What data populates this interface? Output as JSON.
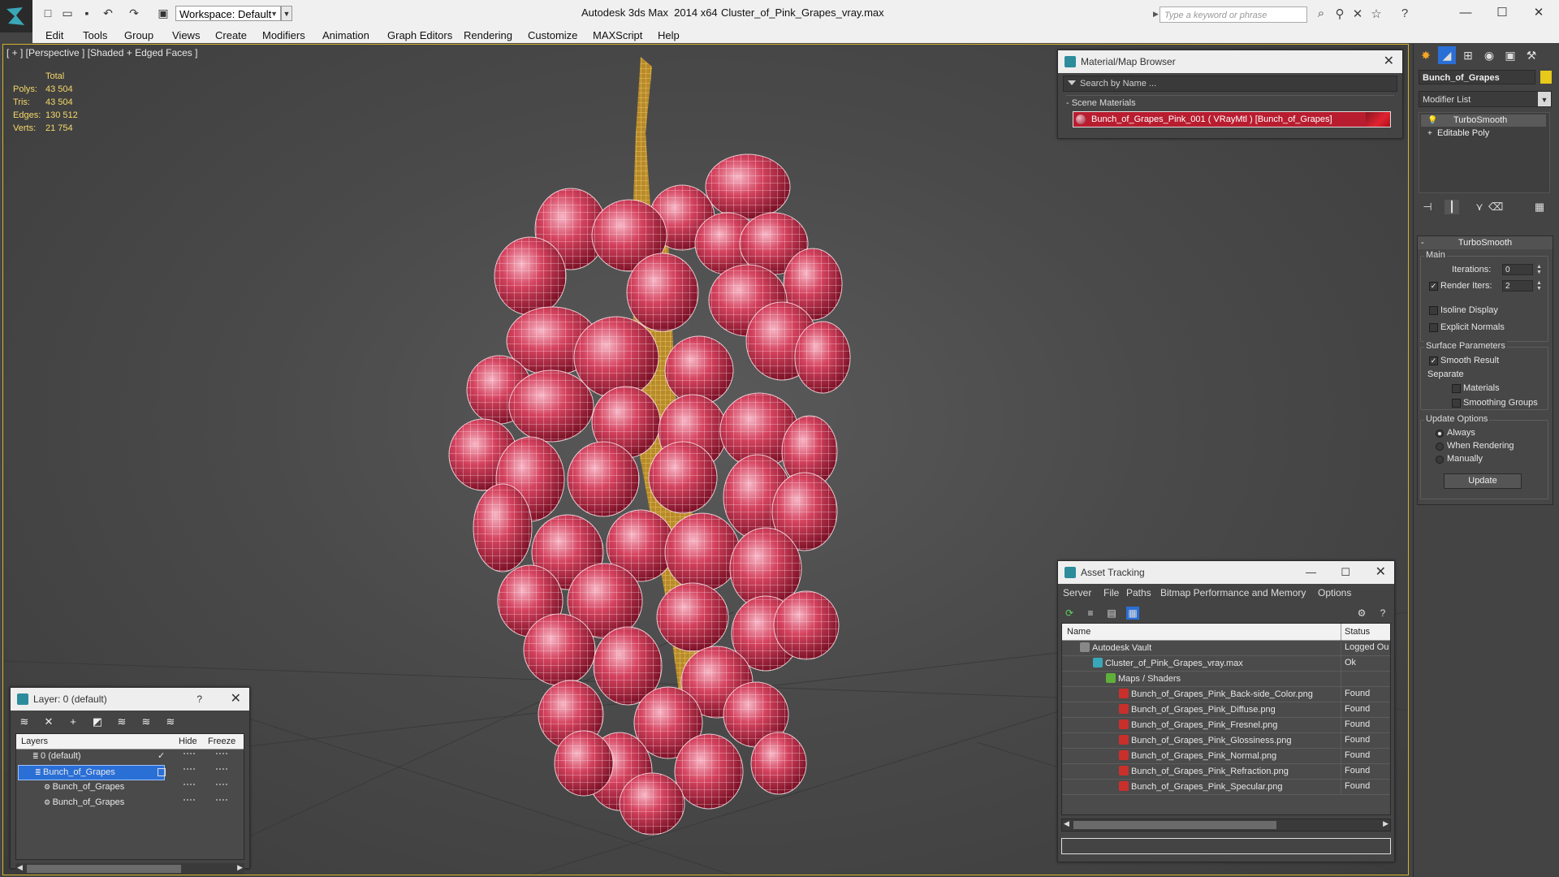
{
  "titlebar": {
    "workspace_label": "Workspace: Default",
    "app_title": "Autodesk 3ds Max  2014 x64",
    "file_name": "Cluster_of_Pink_Grapes_vray.max",
    "search_placeholder": "Type a keyword or phrase"
  },
  "menubar": [
    "Edit",
    "Tools",
    "Group",
    "Views",
    "Create",
    "Modifiers",
    "Animation",
    "Graph Editors",
    "Rendering",
    "Customize",
    "MAXScript",
    "Help"
  ],
  "viewport": {
    "label": "[ + ] [Perspective ] [Shaded + Edged Faces ]",
    "stats": {
      "header": "Total",
      "rows": [
        {
          "k": "Polys:",
          "v": "43 504"
        },
        {
          "k": "Tris:",
          "v": "43 504"
        },
        {
          "k": "Edges:",
          "v": "130 512"
        },
        {
          "k": "Verts:",
          "v": "21 754"
        }
      ]
    }
  },
  "material_browser": {
    "title": "Material/Map Browser",
    "search_placeholder": "Search by Name ...",
    "group": "- Scene Materials",
    "item": "Bunch_of_Grapes_Pink_001  ( VRayMtl )  [Bunch_of_Grapes]"
  },
  "asset_tracking": {
    "title": "Asset Tracking",
    "menu": [
      "Server",
      "File",
      "Paths",
      "Bitmap Performance and Memory",
      "Options"
    ],
    "columns": {
      "name": "Name",
      "status": "Status"
    },
    "rows": [
      {
        "name": "Autodesk Vault",
        "status": "Logged Ou",
        "indent": 1
      },
      {
        "name": "Cluster_of_Pink_Grapes_vray.max",
        "status": "Ok",
        "indent": 2
      },
      {
        "name": "Maps / Shaders",
        "status": "",
        "indent": 3
      },
      {
        "name": "Bunch_of_Grapes_Pink_Back-side_Color.png",
        "status": "Found",
        "indent": 4
      },
      {
        "name": "Bunch_of_Grapes_Pink_Diffuse.png",
        "status": "Found",
        "indent": 4
      },
      {
        "name": "Bunch_of_Grapes_Pink_Fresnel.png",
        "status": "Found",
        "indent": 4
      },
      {
        "name": "Bunch_of_Grapes_Pink_Glossiness.png",
        "status": "Found",
        "indent": 4
      },
      {
        "name": "Bunch_of_Grapes_Pink_Normal.png",
        "status": "Found",
        "indent": 4
      },
      {
        "name": "Bunch_of_Grapes_Pink_Refraction.png",
        "status": "Found",
        "indent": 4
      },
      {
        "name": "Bunch_of_Grapes_Pink_Specular.png",
        "status": "Found",
        "indent": 4
      }
    ]
  },
  "layer_panel": {
    "title": "Layer: 0 (default)",
    "help": "?",
    "columns": {
      "layers": "Layers",
      "hide": "Hide",
      "freeze": "Freeze"
    },
    "rows": [
      {
        "name": "0 (default)",
        "level": 0,
        "selected": false,
        "check": true
      },
      {
        "name": "Bunch_of_Grapes",
        "level": 0,
        "selected": true,
        "check": false
      },
      {
        "name": "Bunch_of_Grapes",
        "level": 1,
        "selected": false,
        "check": false
      },
      {
        "name": "Bunch_of_Grapes",
        "level": 1,
        "selected": false,
        "check": false
      }
    ]
  },
  "command_panel": {
    "object_name": "Bunch_of_Grapes",
    "object_color": "#e6c91b",
    "modifier_list_label": "Modifier List",
    "stack": [
      "TurboSmooth",
      "Editable Poly"
    ],
    "rollout": {
      "title": "TurboSmooth",
      "main_group": "Main",
      "iterations_label": "Iterations:",
      "iterations_value": "0",
      "render_iters_label": "Render Iters:",
      "render_iters_value": "2",
      "isoline_label": "Isoline Display",
      "explicit_normals_label": "Explicit Normals",
      "surface_group": "Surface Parameters",
      "smooth_result_label": "Smooth Result",
      "separate_label": "Separate",
      "materials_label": "Materials",
      "smoothing_groups_label": "Smoothing Groups",
      "update_group": "Update Options",
      "always_label": "Always",
      "when_rendering_label": "When Rendering",
      "manually_label": "Manually",
      "update_button": "Update"
    }
  },
  "colors": {
    "accent_yellow": "#d2b42b",
    "selection_blue": "#2a6fd6",
    "material_red": "#b81d2f",
    "grape_red": "#c4304a"
  }
}
